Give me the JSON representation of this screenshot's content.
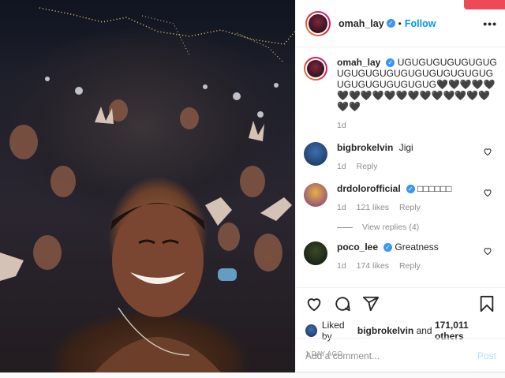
{
  "post": {
    "username": "omah_lay",
    "follow_label": "Follow",
    "dot": "•",
    "more_label": "•••",
    "verified_mark": "✓"
  },
  "comments": [
    {
      "user": "omah_lay",
      "text": "UGUGUGUGUGUGUGUGUGUGUGUGUGUGUGUGUGUGUGUGUGUGUGUGUG🖤🖤🖤🖤🖤🖤🖤🖤🖤🖤🖤🖤🖤🖤🖤🖤🖤🖤🖤🖤",
      "time": "1d",
      "verified": true
    },
    {
      "user": "bigbrokelvin",
      "text": "Jigi",
      "time": "1d",
      "reply_label": "Reply"
    },
    {
      "user": "drdolorofficial",
      "text": "□□□□□□",
      "time": "1d",
      "likes": "121 likes",
      "reply_label": "Reply",
      "view_replies": "View replies (4)",
      "verified": true
    },
    {
      "user": "poco_lee",
      "text": "Greatness",
      "time": "1d",
      "likes": "174 likes",
      "reply_label": "Reply",
      "verified": true
    }
  ],
  "actions": {
    "liked_by_prefix": "Liked by",
    "liked_by_user": "bigbrokelvin",
    "liked_by_and": "and",
    "likes_count": "171,011 others",
    "timestamp": "1 DAY AGO"
  },
  "add_comment": {
    "placeholder": "Add a comment...",
    "post_label": "Post"
  },
  "colors": {
    "accent": "#0095f6",
    "verified": "#3897f0",
    "secondary_text": "#8e8e8e"
  },
  "icons": [
    "heart-icon",
    "comment-icon",
    "share-icon",
    "bookmark-icon",
    "more-icon",
    "verified-icon"
  ]
}
